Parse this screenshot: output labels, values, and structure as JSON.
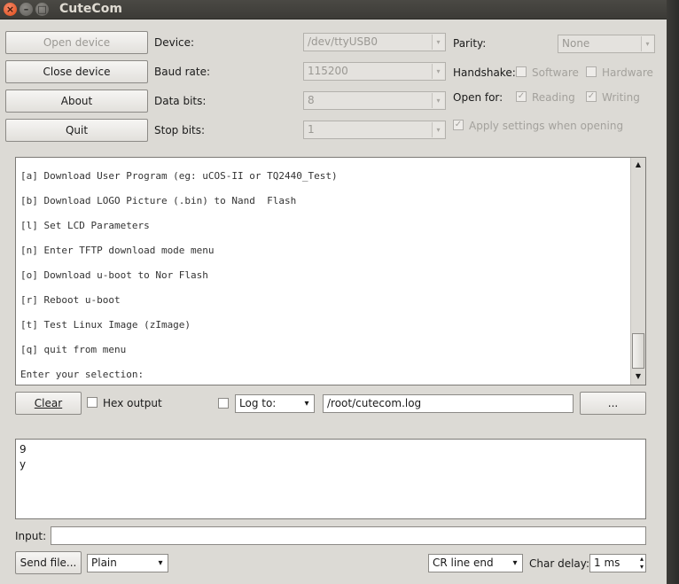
{
  "window": {
    "title": "CuteCom"
  },
  "titlebar_buttons": {
    "close": "×",
    "minimize": "–",
    "maximize": "□"
  },
  "device_buttons": {
    "open": "Open device",
    "close": "Close device",
    "about": "About",
    "quit": "Quit"
  },
  "settings": {
    "device_label": "Device:",
    "device_value": "/dev/ttyUSB0",
    "baud_label": "Baud rate:",
    "baud_value": "115200",
    "databits_label": "Data bits:",
    "databits_value": "8",
    "stopbits_label": "Stop bits:",
    "stopbits_value": "1",
    "parity_label": "Parity:",
    "parity_value": "None",
    "handshake_label": "Handshake:",
    "handshake_software": "Software",
    "handshake_hardware": "Hardware",
    "openfor_label": "Open for:",
    "openfor_reading": "Reading",
    "openfor_writing": "Writing",
    "apply_label": "Apply settings when opening"
  },
  "checks": {
    "checked": "✓",
    "combo_arrow": "▾"
  },
  "terminal": {
    "lines": [
      "[a] Download User Program (eg: uCOS-II or TQ2440_Test)",
      "[b] Download LOGO Picture (.bin) to Nand  Flash",
      "[l] Set LCD Parameters",
      "[n] Enter TFTP download mode menu",
      "[o] Download u-boot to Nor Flash",
      "[r] Reboot u-boot",
      "[t] Test Linux Image (zImage)",
      "[q] quit from menu",
      "Enter your selection:"
    ],
    "scroll_up": "▲",
    "scroll_down": "▼"
  },
  "controls": {
    "clear_label": "Clear",
    "hex_output_label": "Hex output",
    "log_to_value": "Log to:",
    "log_path": "/root/cutecom.log",
    "browse_label": "..."
  },
  "output": {
    "lines": [
      "9",
      "y"
    ]
  },
  "input": {
    "label": "Input:",
    "value": ""
  },
  "footer": {
    "send_file_label": "Send file...",
    "mode_value": "Plain",
    "line_end_value": "CR line end",
    "char_delay_label": "Char delay:",
    "char_delay_value": "1 ms",
    "spin_up": "▴",
    "spin_down": "▾"
  }
}
